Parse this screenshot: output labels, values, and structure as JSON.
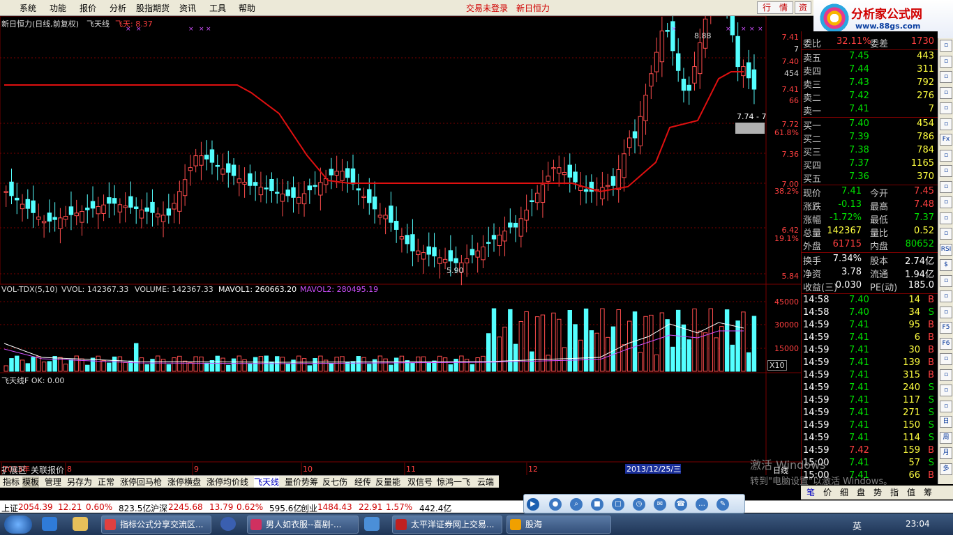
{
  "menu": {
    "items": [
      "系统",
      "功能",
      "报价",
      "分析",
      "股指期货",
      "资讯",
      "工具",
      "帮助"
    ],
    "trade_status": "交易未登录",
    "stock_name": "新日恒力",
    "btn_quote": "行　情",
    "btn_info": "资"
  },
  "logo": {
    "title": "分析家公式网",
    "url": "www.88gs.com"
  },
  "chart": {
    "header": "新日恒力(日线,前复权)",
    "indicator_name": "飞天线",
    "indicator_value": "飞天: 8.37",
    "price_axis": [
      "7.41",
      "7",
      "7.40",
      "454",
      "7.41",
      "66",
      "7.72",
      "61.8%",
      "7.36",
      "7.00",
      "38.2%",
      "6.42",
      "19.1%",
      "5.84"
    ],
    "high_label": "8.88",
    "low_label": "5.90",
    "price_box": "7.74 - 7",
    "volume_header": {
      "name": "VOL-TDX(5,10)",
      "vvol": "VVOL: 142367.33",
      "volume": "VOLUME: 142367.33",
      "mavol1": "MAVOL1: 260663.20",
      "mavol2": "MAVOL2: 280495.19"
    },
    "volume_axis": [
      "45000",
      "30000",
      "15000"
    ],
    "volume_unit": "X10",
    "indicator2": "飞天线F  OK: 0.00",
    "period_label": "日线",
    "date_axis": [
      "2013年",
      "8",
      "9",
      "10",
      "11",
      "12"
    ],
    "date_cursor": "2013/12/25/三",
    "colors": {
      "up": "#ff4d4d",
      "down": "#54ffff",
      "ma_line": "#e01010",
      "mavol1": "#ffffff",
      "mavol2": "#d050ff",
      "grid": "#7a0000"
    }
  },
  "quote": {
    "wei_bi_label": "委比",
    "wei_bi": "32.11%",
    "wei_cha_label": "委差",
    "wei_cha": "1730",
    "asks": [
      {
        "label": "卖五",
        "price": "7.45",
        "vol": "443"
      },
      {
        "label": "卖四",
        "price": "7.44",
        "vol": "311"
      },
      {
        "label": "卖三",
        "price": "7.43",
        "vol": "792"
      },
      {
        "label": "卖二",
        "price": "7.42",
        "vol": "276"
      },
      {
        "label": "卖一",
        "price": "7.41",
        "vol": "7"
      }
    ],
    "bids": [
      {
        "label": "买一",
        "price": "7.40",
        "vol": "454"
      },
      {
        "label": "买二",
        "price": "7.39",
        "vol": "786"
      },
      {
        "label": "买三",
        "price": "7.38",
        "vol": "784"
      },
      {
        "label": "买四",
        "price": "7.37",
        "vol": "1165"
      },
      {
        "label": "买五",
        "price": "7.36",
        "vol": "370"
      }
    ],
    "stats": [
      {
        "l1": "现价",
        "v1": "7.41",
        "l2": "今开",
        "v2": "7.45",
        "c1": "green",
        "c2": "red"
      },
      {
        "l1": "涨跌",
        "v1": "-0.13",
        "l2": "最高",
        "v2": "7.48",
        "c1": "green",
        "c2": "red"
      },
      {
        "l1": "涨幅",
        "v1": "-1.72%",
        "l2": "最低",
        "v2": "7.37",
        "c1": "green",
        "c2": "green"
      },
      {
        "l1": "总量",
        "v1": "142367",
        "l2": "量比",
        "v2": "0.52",
        "c1": "yellow",
        "c2": "yellow"
      },
      {
        "l1": "外盘",
        "v1": "61715",
        "l2": "内盘",
        "v2": "80652",
        "c1": "red",
        "c2": "green"
      }
    ],
    "stats2": [
      {
        "l1": "换手",
        "v1": "7.34%",
        "l2": "股本",
        "v2": "2.74亿"
      },
      {
        "l1": "净资",
        "v1": "3.78",
        "l2": "流通",
        "v2": "1.94亿"
      },
      {
        "l1": "收益(三)",
        "v1": "0.030",
        "l2": "PE(动)",
        "v2": "185.0"
      }
    ],
    "ticks": [
      {
        "t": "14:58",
        "p": "7.40",
        "v": "14",
        "s": "B"
      },
      {
        "t": "14:58",
        "p": "7.40",
        "v": "34",
        "s": "S"
      },
      {
        "t": "14:59",
        "p": "7.41",
        "v": "95",
        "s": "B"
      },
      {
        "t": "14:59",
        "p": "7.41",
        "v": "6",
        "s": "B"
      },
      {
        "t": "14:59",
        "p": "7.41",
        "v": "30",
        "s": "B"
      },
      {
        "t": "14:59",
        "p": "7.41",
        "v": "139",
        "s": "B"
      },
      {
        "t": "14:59",
        "p": "7.41",
        "v": "315",
        "s": "B"
      },
      {
        "t": "14:59",
        "p": "7.41",
        "v": "240",
        "s": "S"
      },
      {
        "t": "14:59",
        "p": "7.41",
        "v": "117",
        "s": "S"
      },
      {
        "t": "14:59",
        "p": "7.41",
        "v": "271",
        "s": "S"
      },
      {
        "t": "14:59",
        "p": "7.41",
        "v": "150",
        "s": "S"
      },
      {
        "t": "14:59",
        "p": "7.41",
        "v": "114",
        "s": "S"
      },
      {
        "t": "14:59",
        "p": "7.42",
        "v": "159",
        "s": "B"
      },
      {
        "t": "15:00",
        "p": "7.41",
        "v": "57",
        "s": "S"
      },
      {
        "t": "15:00",
        "p": "7.41",
        "v": "66",
        "s": "B"
      }
    ],
    "bottom_tabs": [
      "笔",
      "价",
      "细",
      "盘",
      "势",
      "指",
      "值",
      "筹"
    ]
  },
  "iconbar": [
    "",
    "",
    "",
    "",
    "",
    "",
    "Fx",
    "",
    "",
    "",
    "",
    "",
    "",
    "RSI",
    "$",
    "",
    "",
    "",
    "F5",
    "F6",
    "",
    "",
    "",
    "",
    "日",
    "周",
    "月",
    "多"
  ],
  "tabs": [
    "扩展区",
    "关联报价",
    "指标",
    "模板",
    "管理",
    "另存为",
    "正常",
    "涨停回马枪",
    "涨停横盘",
    "涨停均价线",
    "飞天线",
    "量价势筹",
    "反七伤",
    "经传",
    "反量能",
    "双信号",
    "惊鸿一飞",
    "云端"
  ],
  "index_bar": {
    "sh_label": "上证",
    "sh": "2054.39",
    "sh_chg": "12.21",
    "sh_pct": "0.60%",
    "sh_amt": "823.5亿",
    "hs_label": "沪深",
    "hs": "2245.68",
    "hs_chg": "13.79",
    "hs_pct": "0.62%",
    "hs_amt": "595.6亿",
    "cy_label": "创业",
    "cy": "1484.43",
    "cy_chg": "22.91",
    "cy_pct": "1.57%",
    "cy_amt": "442.4亿"
  },
  "watermark": {
    "line1": "激活 Windows",
    "line2": "转到\"电脑设置\"以激活 Windows。"
  },
  "taskbar": {
    "items": [
      "指标公式分享交流区...",
      "男人如衣服--喜剧-...",
      "太平洋证券网上交易...",
      "股海"
    ],
    "ime": "英",
    "time": "23:04"
  }
}
